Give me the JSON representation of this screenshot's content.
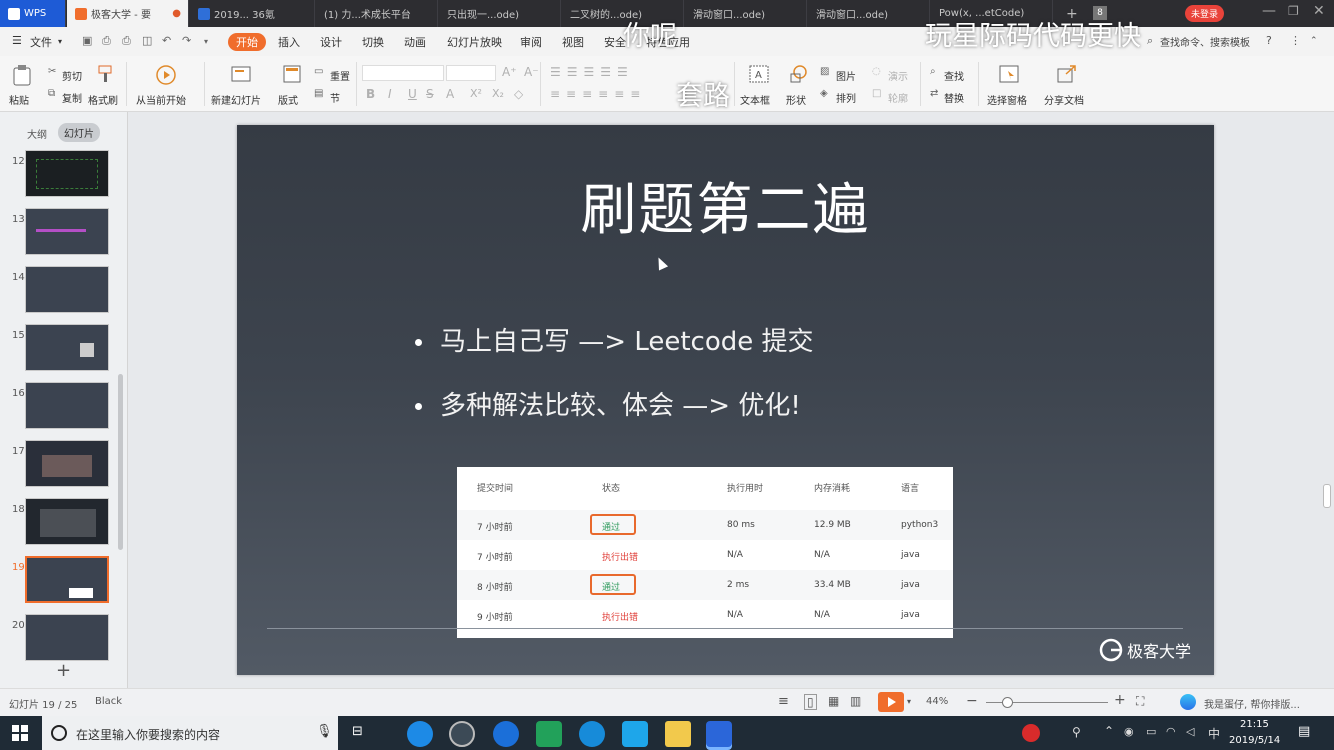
{
  "tabs": [
    {
      "label": "WPS"
    },
    {
      "label": "极客大学 - 要"
    },
    {
      "label": "2019... 36氪"
    },
    {
      "label": "(1) 力...术成长平台"
    },
    {
      "label": "只出现一...ode)"
    },
    {
      "label": "二叉树的...ode)"
    },
    {
      "label": "滑动窗口...ode)"
    },
    {
      "label": "滑动窗口...ode)"
    },
    {
      "label": "Pow(x, ...etCode)"
    }
  ],
  "account": {
    "login_label": "未登录",
    "tab_count": "8"
  },
  "menu": {
    "file": "文件",
    "items": [
      "开始",
      "插入",
      "设计",
      "切换",
      "动画",
      "幻灯片放映",
      "审阅",
      "视图",
      "安全",
      "特色应用"
    ],
    "search_placeholder": "查找命令、搜索模板"
  },
  "ribbon": {
    "paste": "粘贴",
    "cut": "剪切",
    "copy": "复制",
    "format_painter": "格式刷",
    "play_from_current": "从当前开始",
    "new_slide": "新建幻灯片",
    "layout": "版式",
    "reset": "重置",
    "section": "节",
    "textbox": "文本框",
    "shape": "形状",
    "picture": "图片",
    "arrange": "排列",
    "find": "查找",
    "replace": "替换",
    "selection_pane": "选择窗格",
    "share": "分享文档",
    "style_gray": "演示",
    "outline_gray": "轮廓"
  },
  "panel": {
    "outline_tab": "大纲",
    "slides_tab": "幻灯片",
    "slide_numbers": [
      "12",
      "13",
      "14",
      "15",
      "16",
      "17",
      "18",
      "19",
      "20"
    ],
    "add_icon": "plus-icon"
  },
  "slide": {
    "title": "刷题第二遍",
    "bullets": [
      "马上自己写 —> Leetcode 提交",
      "多种解法比较、体会 —> 优化!"
    ],
    "table": {
      "headers": [
        "提交时间",
        "状态",
        "执行用时",
        "内存消耗",
        "语言"
      ],
      "rows": [
        {
          "time": "7 小时前",
          "status": "通过",
          "runtime": "80 ms",
          "memory": "12.9 MB",
          "lang": "python3"
        },
        {
          "time": "7 小时前",
          "status": "执行出错",
          "runtime": "N/A",
          "memory": "N/A",
          "lang": "java"
        },
        {
          "time": "8 小时前",
          "status": "通过",
          "runtime": "2 ms",
          "memory": "33.4 MB",
          "lang": "java"
        },
        {
          "time": "9 小时前",
          "status": "执行出错",
          "runtime": "N/A",
          "memory": "N/A",
          "lang": "java"
        }
      ]
    },
    "logo_text": "极客大学"
  },
  "status": {
    "slide_counter": "幻灯片 19 / 25",
    "theme": "Black",
    "zoom": "44%",
    "assistant": "我是蛋仔, 帮你排版..."
  },
  "taskbar": {
    "search_placeholder": "在这里输入你要搜索的内容",
    "time": "21:15",
    "date": "2019/5/14",
    "ime": "中"
  },
  "overlays": {
    "top_left": "你呢",
    "top_right": "玩星际码代码更快",
    "middle": "套路"
  },
  "colors": {
    "accent": "#f06d2c",
    "pass": "#2d9a5b",
    "error": "#e0413b"
  }
}
